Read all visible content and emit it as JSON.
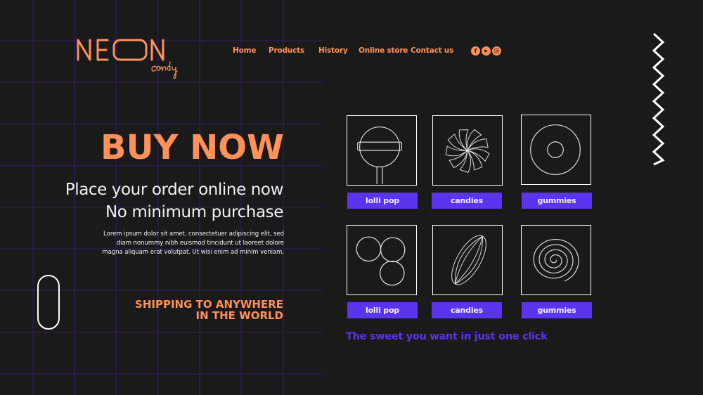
{
  "brand": {
    "name": "NEON",
    "sub": "candy",
    "color": "#ff9159"
  },
  "nav": {
    "items": [
      {
        "label": "Home"
      },
      {
        "label": "Products"
      },
      {
        "label": "History"
      },
      {
        "label": "Online store"
      },
      {
        "label": "Contact us"
      }
    ],
    "social": [
      {
        "icon": "facebook-icon",
        "glyph": "f"
      },
      {
        "icon": "youtube-icon",
        "glyph": "▶"
      },
      {
        "icon": "instagram-icon",
        "glyph": "◎"
      }
    ]
  },
  "hero": {
    "headline": "BUY NOW",
    "sub_line1": "Place your order online now",
    "sub_line2": "No minimum purchase",
    "lorem_line1": "Lorem ipsum dolor sit amet, consectetuer adipiscing elit, sed",
    "lorem_line2": "diam nonummy nibh euismod tincidunt ut laoreet dolore",
    "lorem_line3": "magna aliquam erat volutpat. Ut wisi enim ad minim veniam,",
    "shipping_line1": "SHIPPING TO ANYWHERE",
    "shipping_line2": "IN THE WORLD"
  },
  "products": [
    {
      "label": "lolli pop",
      "icon": "lollipop-icon"
    },
    {
      "label": "candies",
      "icon": "swirl-candy-icon"
    },
    {
      "label": "gummies",
      "icon": "ring-gummy-icon"
    },
    {
      "label": "lolli pop",
      "icon": "three-balls-icon"
    },
    {
      "label": "candies",
      "icon": "striped-candy-icon"
    },
    {
      "label": "gummies",
      "icon": "spiral-gummy-icon"
    }
  ],
  "tagline": "The sweet you want in just one click",
  "colors": {
    "background": "#1a1a1a",
    "accent_orange": "#ff9159",
    "accent_purple": "#5b34f0",
    "grid": "#2b1e5c"
  }
}
